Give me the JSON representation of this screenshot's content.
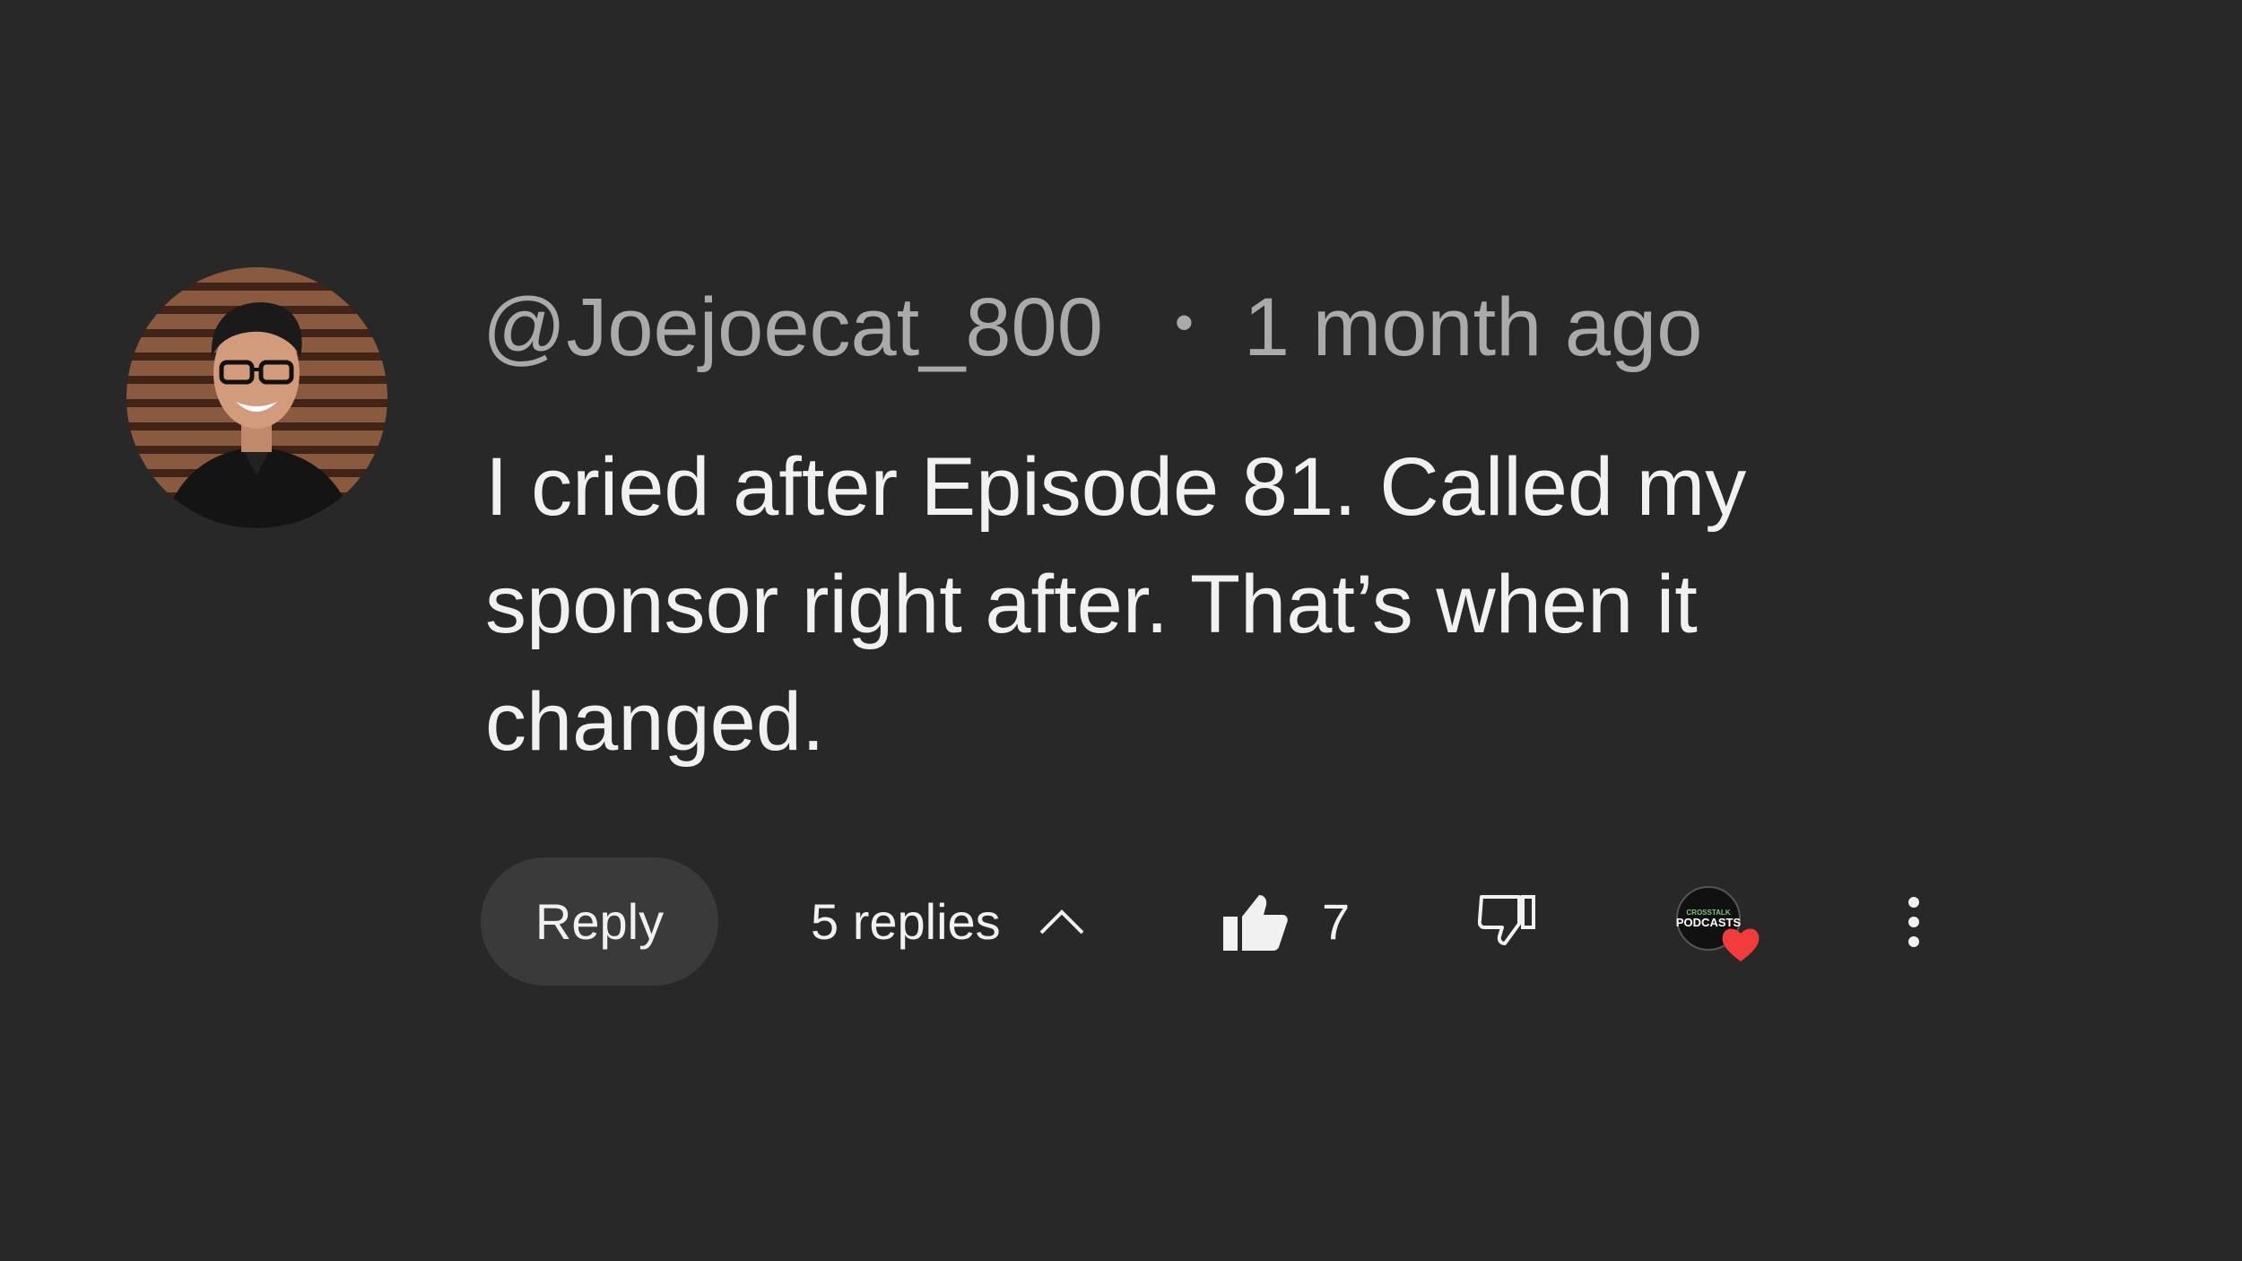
{
  "comment": {
    "author": "@Joejoecat_800",
    "separator": "•",
    "timestamp": "1 month ago",
    "text": "I cried after Episode 81. Called my sponsor right after. That’s when it changed."
  },
  "actions": {
    "reply_label": "Reply",
    "replies_label": "5 replies",
    "like_count": "7",
    "creator_avatar": {
      "line1": "CROSSTALK",
      "line2": "PODCASTS"
    }
  },
  "icons": {
    "like": "thumbs-up-icon",
    "dislike": "thumbs-down-icon",
    "replies_toggle": "chevron-up-icon",
    "creator_heart": "heart-icon",
    "more": "more-vertical-icon"
  },
  "colors": {
    "background": "#282828",
    "secondary_text": "#aaaaaa",
    "primary_text": "#f1f1f1",
    "reply_button_bg": "#3a3a3a",
    "heart": "#f23c3c"
  }
}
